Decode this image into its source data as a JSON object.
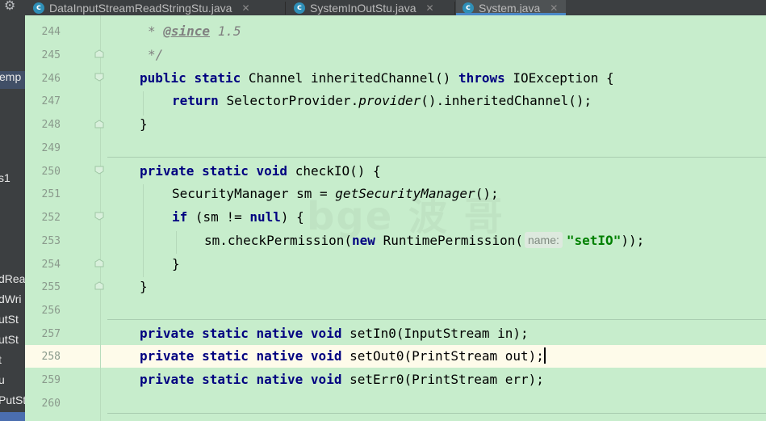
{
  "tabs": [
    {
      "label": "DataInputStreamReadStringStu.java",
      "icon": "java-class-icon",
      "active": false
    },
    {
      "label": "SystemInOutStu.java",
      "icon": "java-class-icon",
      "active": false
    },
    {
      "label": "System.java",
      "icon": "java-class-icon",
      "active": true
    }
  ],
  "project_panel": {
    "items": [
      "emp",
      "s1",
      "dRea",
      "dWri",
      "utSt",
      "utSt",
      "t",
      "u",
      "PutSt"
    ]
  },
  "editor": {
    "line_numbers": [
      "244",
      "245",
      "246",
      "247",
      "248",
      "249",
      "250",
      "251",
      "252",
      "253",
      "254",
      "255",
      "256",
      "257",
      "258",
      "259",
      "260"
    ],
    "current_line": "258",
    "code": {
      "l244_a": "* ",
      "l244_tag": "@since",
      "l244_b": " 1.5",
      "l245": "*/",
      "l246_kw1": "public",
      "l246_kw2": "static",
      "l246_a": "Channel inheritedChannel()",
      "l246_kw3": "throws",
      "l246_b": "IOException {",
      "l247_kw": "return",
      "l247_a": "SelectorProvider.",
      "l247_it": "provider",
      "l247_b": "().inheritedChannel();",
      "l248": "}",
      "l250_kw1": "private",
      "l250_kw2": "static",
      "l250_kw3": "void",
      "l250_a": "checkIO() {",
      "l251_a": "SecurityManager sm = ",
      "l251_it": "getSecurityManager",
      "l251_b": "();",
      "l252_kw": "if",
      "l252_a": "(sm != ",
      "l252_kw2": "null",
      "l252_b": ") {",
      "l253_a": "sm.checkPermission(",
      "l253_kw": "new",
      "l253_b": "RuntimePermission(",
      "l253_hint": "name:",
      "l253_str": "\"setIO\"",
      "l253_c": "));",
      "l254": "}",
      "l255": "}",
      "l257_kw": "private static native void",
      "l257_a": "setIn0(InputStream in);",
      "l258_kw": "private static native void",
      "l258_a": "setOut0(PrintStream out);",
      "l259_kw": "private static native void",
      "l259_a": "setErr0(PrintStream err);"
    }
  },
  "watermark": "bge 波 哥",
  "colors": {
    "editor_bg": "#c7edcc",
    "keyword": "#000080",
    "string": "#008000",
    "current_line": "#fefbea",
    "tab_bar": "#3c3f41"
  }
}
